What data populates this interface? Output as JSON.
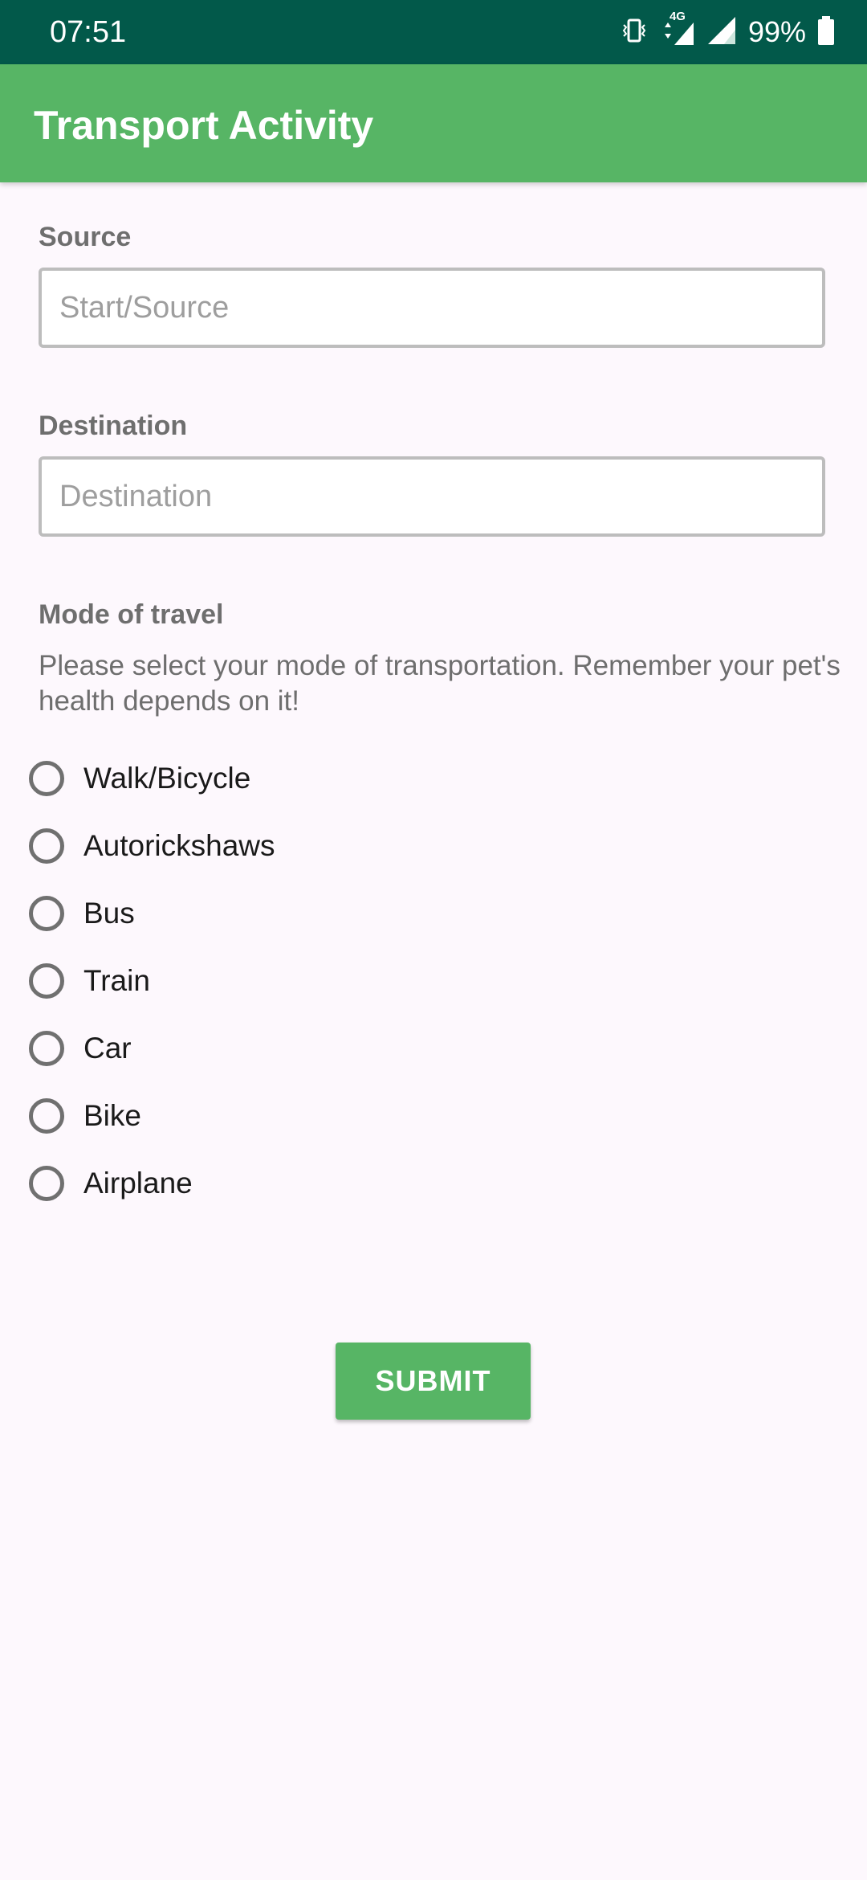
{
  "status_bar": {
    "time": "07:51",
    "network_badge": "4G",
    "battery_percent": "99%",
    "icons": [
      "vibrate-icon",
      "data-arrows-icon",
      "signal-icon",
      "signal-icon",
      "battery-icon"
    ]
  },
  "app_bar": {
    "title": "Transport Activity",
    "color": "#57b565"
  },
  "source": {
    "label": "Source",
    "placeholder": "Start/Source",
    "value": ""
  },
  "destination": {
    "label": "Destination",
    "placeholder": "Destination",
    "value": ""
  },
  "mode": {
    "label": "Mode of travel",
    "description": "Please select your mode of transportation. Remember your pet's health depends on it!",
    "options": [
      {
        "label": "Walk/Bicycle",
        "selected": false
      },
      {
        "label": "Autorickshaws",
        "selected": false
      },
      {
        "label": "Bus",
        "selected": false
      },
      {
        "label": "Train",
        "selected": false
      },
      {
        "label": "Car",
        "selected": false
      },
      {
        "label": "Bike",
        "selected": false
      },
      {
        "label": "Airplane",
        "selected": false
      }
    ]
  },
  "submit": {
    "label": "SUBMIT"
  }
}
